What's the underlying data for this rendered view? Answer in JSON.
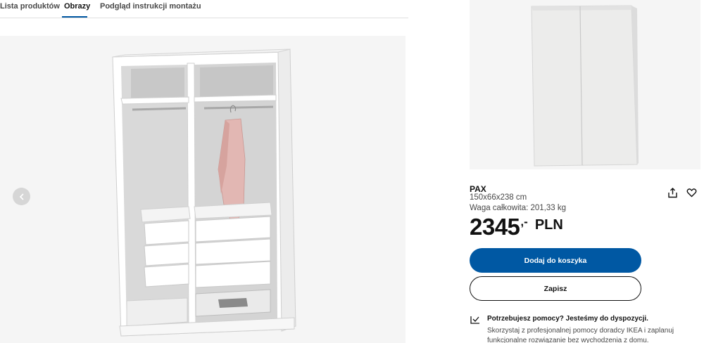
{
  "tabs": [
    {
      "label": "Lista produktów"
    },
    {
      "label": "Obrazy"
    },
    {
      "label": "Podgląd instrukcji montażu"
    }
  ],
  "active_tab": "Obrazy",
  "viewer": {
    "prev_icon": "chevron-left-icon"
  },
  "product": {
    "name": "PAX",
    "dimensions": "150x66x238 cm",
    "weight": "Waga całkowita: 201,33 kg",
    "price_integer": "2345",
    "price_suffix": ",-",
    "currency": "PLN",
    "share_icon": "share-icon",
    "favourite_icon": "heart-icon"
  },
  "buttons": {
    "add_to_cart": "Dodaj do koszyka",
    "save": "Zapisz"
  },
  "help": {
    "icon": "chat-check-icon",
    "title": "Potrzebujesz pomocy? Jesteśmy do dyspozycji.",
    "text": "Skorzystaj z profesjonalnej pomocy doradcy IKEA i zaplanuj funkcjonalne rozwiązanie bez wychodzenia z domu."
  },
  "colors": {
    "primary": "#0058a3",
    "image_bg": "#f5f5f5"
  }
}
